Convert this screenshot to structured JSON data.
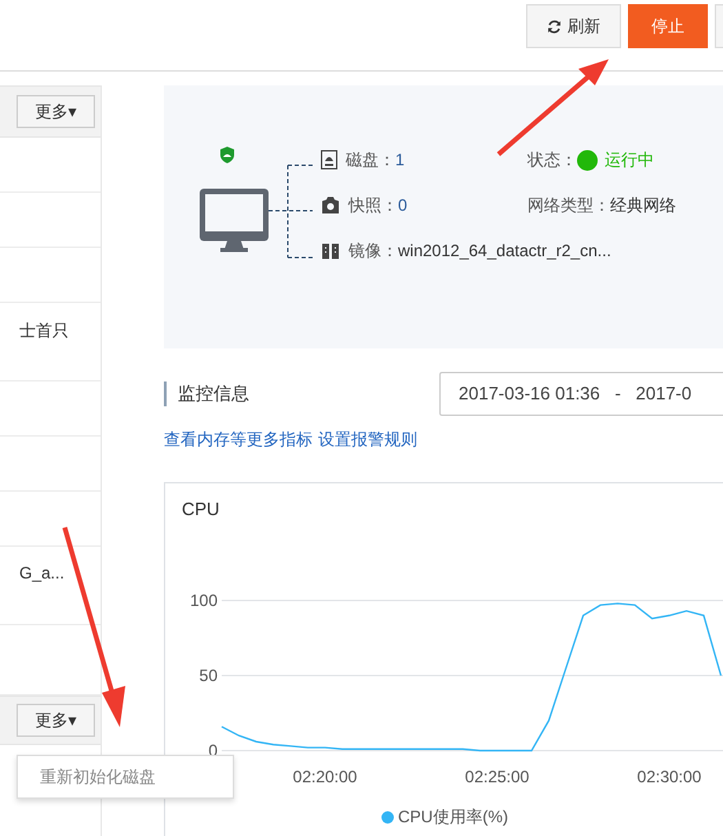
{
  "toolbar": {
    "buttons": [
      {
        "label": "刷新",
        "kind": "refresh"
      },
      {
        "label": "停止",
        "kind": "primary"
      },
      {
        "kind": "cut"
      }
    ]
  },
  "left_panel": {
    "more_buttons": [
      "更多▾",
      "更多▾"
    ],
    "row_texts": [
      "士首只",
      "G_a..."
    ],
    "menu": {
      "items": [
        "重新初始化磁盘"
      ]
    }
  },
  "instance": {
    "details": [
      {
        "label": "磁盘：",
        "value": "1",
        "kind": "disk"
      },
      {
        "label": "快照：",
        "value": "0",
        "kind": "snapshot"
      },
      {
        "label": "镜像：",
        "value": "win2012_64_datactr_r2_cn...",
        "kind": "image"
      }
    ],
    "status": {
      "label": "状态：",
      "value": "运行中",
      "color": "#22b80a"
    },
    "network": {
      "label": "网络类型：",
      "value": "经典网络"
    }
  },
  "monitor": {
    "title": "监控信息",
    "date_range": "2017-03-16 01:36   -   2017-0",
    "links": [
      "查看内存等更多指标",
      "设置报警规则"
    ],
    "chart": {
      "title": "CPU",
      "chart_data": {
        "type": "line",
        "categories": [
          null,
          null,
          null,
          null,
          null,
          null,
          "02:20:00",
          null,
          null,
          null,
          null,
          null,
          null,
          null,
          null,
          null,
          "02:25:00",
          null,
          null,
          null,
          null,
          null,
          null,
          null,
          null,
          null,
          "02:30:00",
          null,
          null,
          null
        ],
        "ylim": [
          0,
          100
        ],
        "yticks": [
          0,
          50,
          100
        ],
        "series": [
          {
            "name": "CPU使用率(%)",
            "color": "#33b5f5",
            "values": [
              16,
              10,
              6,
              4,
              3,
              2,
              2,
              1,
              1,
              1,
              1,
              1,
              1,
              1,
              1,
              0,
              0,
              0,
              0,
              20,
              55,
              90,
              97,
              98,
              97,
              88,
              90,
              93,
              90,
              50
            ]
          }
        ]
      }
    }
  }
}
